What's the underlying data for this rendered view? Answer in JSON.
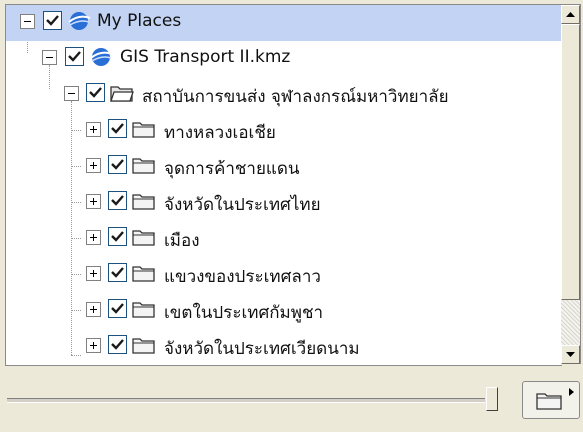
{
  "tree": {
    "rows": [
      {
        "label": "My Places",
        "icon": "globe-icon",
        "checked": true
      },
      {
        "label": "GIS Transport II.kmz",
        "icon": "globe-icon",
        "checked": true
      },
      {
        "label": "สถาบันการขนส่ง จุฬาลงกรณ์มหาวิทยาลัย",
        "icon": "open-folder-icon",
        "checked": true
      },
      {
        "label": "ทางหลวงเอเชีย",
        "icon": "folder-icon",
        "checked": true
      },
      {
        "label": "จุดการค้าชายแดน",
        "icon": "folder-icon",
        "checked": true
      },
      {
        "label": "จังหวัดในประเทศไทย",
        "icon": "folder-icon",
        "checked": true
      },
      {
        "label": "เมือง",
        "icon": "folder-icon",
        "checked": true
      },
      {
        "label": "แขวงของประเทศลาว",
        "icon": "folder-icon",
        "checked": true
      },
      {
        "label": "เขตในประเทศกัมพูชา",
        "icon": "folder-icon",
        "checked": true
      },
      {
        "label": "จังหวัดในประเทศเวียดนาม",
        "icon": "folder-icon",
        "checked": true
      }
    ]
  },
  "colors": {
    "selection": "#c3d3f3",
    "globe": "#2a6fd6",
    "checkbox_border": "#1c5180",
    "check": "#1a7a1a"
  },
  "slider": {
    "level": 1.0
  },
  "toolbar": {
    "folder_button_icon": "folder-menu-icon"
  }
}
